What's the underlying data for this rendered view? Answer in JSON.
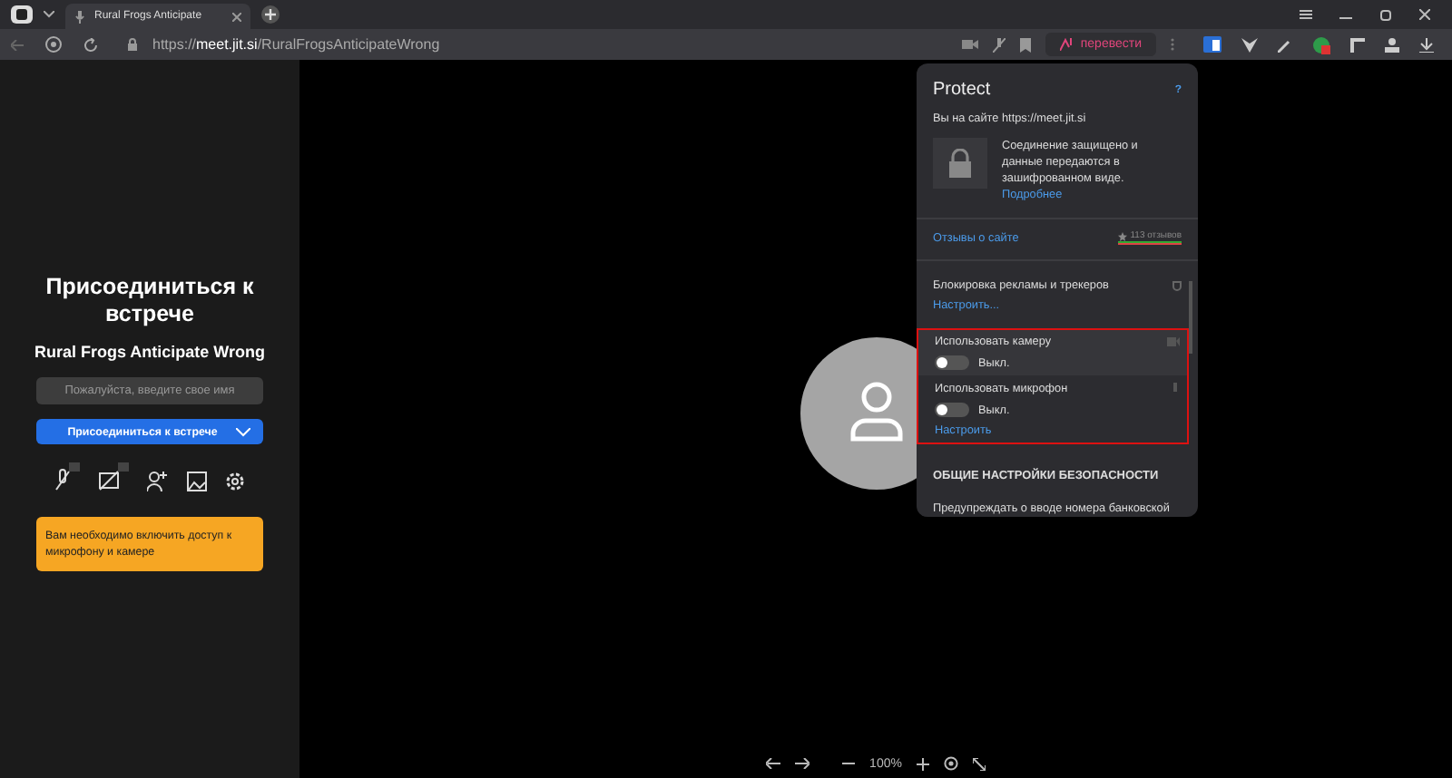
{
  "browser": {
    "tab_title": "Rural Frogs Anticipate",
    "url": "https://**meet.jit.si**/RuralFrogsAnticipateWrong",
    "translate_button": "перевести"
  },
  "prejoin": {
    "title": "Присоединиться к встрече",
    "meeting_name": "Rural Frogs Anticipate Wrong",
    "name_field": {
      "placeholder": "Пожалуйста, введите свое имя"
    },
    "join_button": "Присоединиться к встрече",
    "warning": "Вам необходимо включить доступ к микрофону и камере"
  },
  "protect": {
    "title": "Protect",
    "help": "?",
    "site_line": "Вы на сайте https://meet.jit.si",
    "security_text": "Соединение защищено и данные передаются в зашифрованном виде.",
    "more_link": "Подробнее",
    "reviews_link": "Отзывы о сайте",
    "reviews_count": "113 отзывов",
    "settings": [
      {
        "kind": "link",
        "label": "Блокировка рекламы и трекеров",
        "link": "Настроить..."
      },
      {
        "kind": "toggle",
        "label": "Использовать камеру",
        "on": false,
        "state": "Выкл."
      },
      {
        "kind": "toggle",
        "label": "Использовать микрофон",
        "on": false,
        "state": "Выкл.",
        "link": "Настроить"
      }
    ],
    "section_heading": "ОБЩИЕ НАСТРОЙКИ БЕЗОПАСНОСТИ",
    "cut_text": "Предупреждать о вводе номера банковской"
  },
  "zoom_bar": {
    "level_text": "100%"
  }
}
